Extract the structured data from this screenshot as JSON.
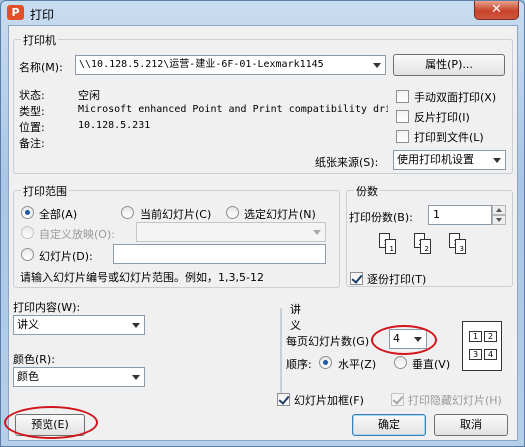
{
  "window": {
    "icon_letter": "P",
    "title": "打印",
    "close_symbol": "✕"
  },
  "printer": {
    "group_label": "打印机",
    "name_label": "名称(M):",
    "name_value": "\\\\10.128.5.212\\运营-建业-6F-01-Lexmark1145",
    "properties_button": "属性(P)...",
    "status_label": "状态:",
    "status_value": "空闲",
    "type_label": "类型:",
    "type_value": "Microsoft enhanced Point and Print compatibility dri",
    "location_label": "位置:",
    "location_value": "10.128.5.231",
    "comment_label": "备注:",
    "manual_duplex": "手动双面打印(X)",
    "reverse_print": "反片打印(I)",
    "print_to_file": "打印到文件(L)",
    "paper_source_label": "纸张来源(S):",
    "paper_source_value": "使用打印机设置"
  },
  "range": {
    "group_label": "打印范围",
    "all": "全部(A)",
    "current_slide": "当前幻灯片(C)",
    "selected_slides": "选定幻灯片(N)",
    "custom_show": "自定义放映(O):",
    "slides": "幻灯片(D):",
    "hint": "请输入幻灯片编号或幻灯片范围。例如，1,3,5-12"
  },
  "copies": {
    "group_label": "份数",
    "count_label": "打印份数(B):",
    "count_value": "1",
    "collate": "逐份打印(T)",
    "icon_pages": [
      "1",
      "1",
      "2",
      "2",
      "3",
      "3"
    ]
  },
  "content": {
    "label": "打印内容(W):",
    "value": "讲义",
    "color_label": "颜色(R):",
    "color_value": "颜色"
  },
  "handouts": {
    "group_label": "讲义",
    "per_page_label": "每页幻灯片数(G)",
    "per_page_value": "4",
    "order_label": "顺序:",
    "horizontal": "水平(Z)",
    "vertical": "垂直(V)",
    "preview_numbers": [
      "1",
      "2",
      "3",
      "4"
    ]
  },
  "frame_slides": "幻灯片加框(F)",
  "print_hidden": "打印隐藏幻灯片(H)",
  "buttons": {
    "preview": "预览(E)",
    "ok": "确定",
    "cancel": "取消"
  }
}
